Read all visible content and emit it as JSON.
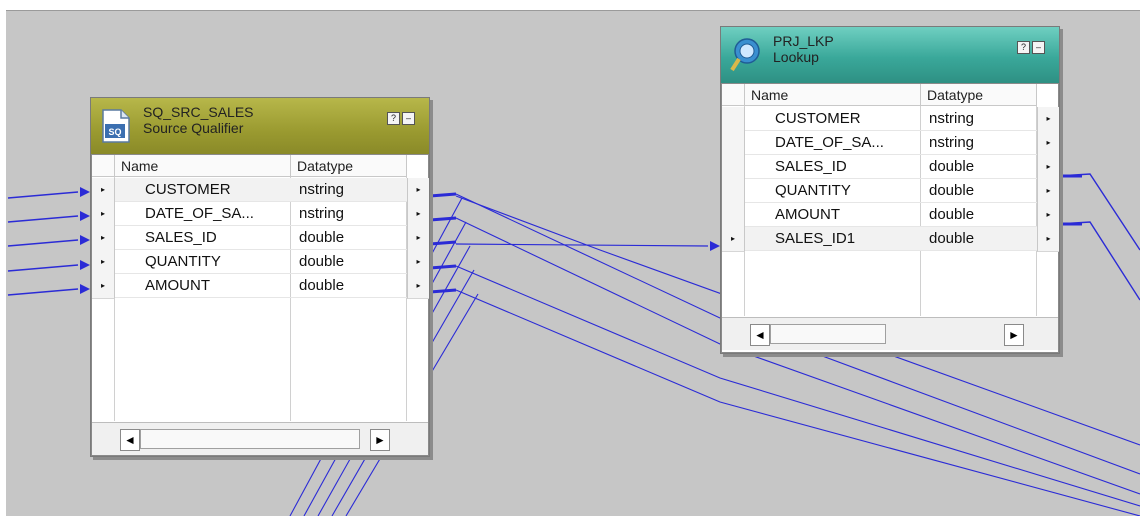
{
  "transformations": {
    "source_qualifier": {
      "name": "SQ_SRC_SALES",
      "type": "Source Qualifier",
      "icon": "source-qualifier-icon",
      "header_color": "#9a9a30",
      "help_label": "?",
      "minimize_label": "–",
      "col_name": "Name",
      "col_type": "Datatype",
      "ports": [
        {
          "name": "CUSTOMER",
          "type": "nstring"
        },
        {
          "name": "DATE_OF_SA...",
          "type": "nstring"
        },
        {
          "name": "SALES_ID",
          "type": "double"
        },
        {
          "name": "QUANTITY",
          "type": "double"
        },
        {
          "name": "AMOUNT",
          "type": "double"
        }
      ],
      "port_marker": "▸",
      "scroll_left": "◄",
      "scroll_right": "►"
    },
    "lookup": {
      "name": "PRJ_LKP",
      "type": "Lookup",
      "icon": "lookup-icon",
      "header_color": "#3aa89a",
      "help_label": "?",
      "minimize_label": "–",
      "col_name": "Name",
      "col_type": "Datatype",
      "ports": [
        {
          "name": "CUSTOMER",
          "type": "nstring"
        },
        {
          "name": "DATE_OF_SA...",
          "type": "nstring"
        },
        {
          "name": "SALES_ID",
          "type": "double"
        },
        {
          "name": "QUANTITY",
          "type": "double"
        },
        {
          "name": "AMOUNT",
          "type": "double"
        },
        {
          "name": "SALES_ID1",
          "type": "double"
        }
      ],
      "port_marker": "▸",
      "scroll_left": "◄",
      "scroll_right": "►"
    }
  },
  "link_color": "#2b2bd6"
}
